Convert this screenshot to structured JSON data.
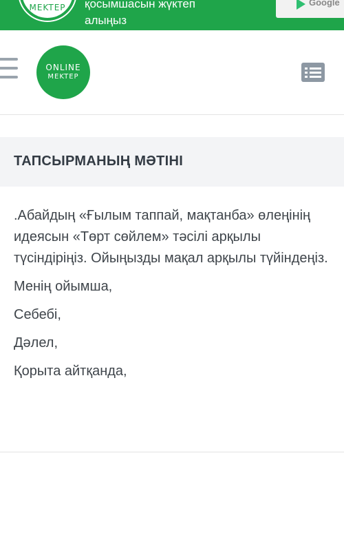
{
  "banner": {
    "logo_text": "MEKTEP",
    "text_line1": "қосымшасын жүктеп",
    "text_line2": "алыңыз",
    "store_text": "Google"
  },
  "header": {
    "logo_line1": "ONLINE",
    "logo_line2": "MEKTEP"
  },
  "task": {
    "title": "ТАПСЫРМАНЫҢ МӘТІНІ",
    "text": ".Абайдың «Ғылым таппай, мақтанба» өлеңінің идеясын «Төрт сөйлем» тәсілі арқылы түсіндіріңіз. Ойыңызды мақал арқылы түйіндеңіз.",
    "lines": [
      "Менің ойымша,",
      "Себебі,",
      "Дәлел,",
      "Қорыта айтқанда,"
    ]
  },
  "colors": {
    "brand_green": "#1fa54a",
    "icon_gray": "#8d98a3",
    "title_bg": "#f3f4f6"
  }
}
